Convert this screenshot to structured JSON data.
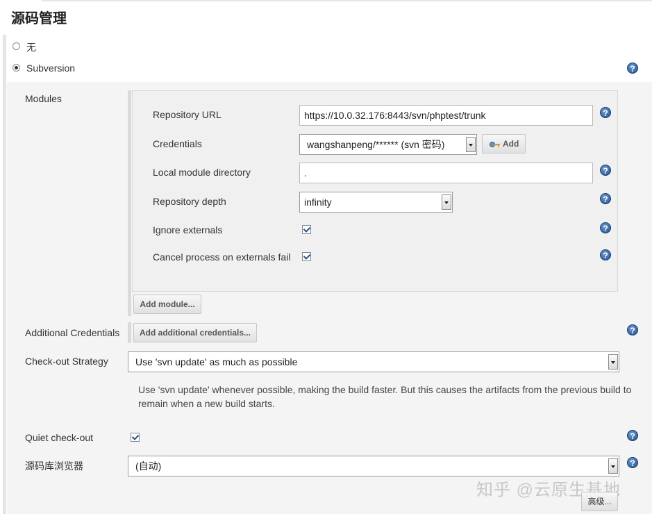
{
  "section": {
    "title": "源码管理"
  },
  "scm_options": [
    {
      "label": "无",
      "selected": false
    },
    {
      "label": "Subversion",
      "selected": true
    }
  ],
  "modules": {
    "label": "Modules",
    "repository_url": {
      "label": "Repository URL",
      "value": "https://10.0.32.176:8443/svn/phptest/trunk"
    },
    "credentials": {
      "label": "Credentials",
      "value": "wangshanpeng/****** (svn 密码)",
      "add_label": "Add"
    },
    "local_module_directory": {
      "label": "Local module directory",
      "value": "."
    },
    "repository_depth": {
      "label": "Repository depth",
      "value": "infinity"
    },
    "ignore_externals": {
      "label": "Ignore externals",
      "checked": true
    },
    "cancel_process": {
      "label": "Cancel process on externals fail",
      "checked": true
    },
    "add_module_label": "Add module..."
  },
  "additional_credentials": {
    "label": "Additional Credentials",
    "button_label": "Add additional credentials..."
  },
  "checkout_strategy": {
    "label": "Check-out Strategy",
    "value": "Use 'svn update' as much as possible",
    "description": "Use 'svn update' whenever possible, making the build faster. But this causes the artifacts from the previous build to remain when a new build starts."
  },
  "quiet_checkout": {
    "label": "Quiet check-out",
    "checked": false
  },
  "repo_browser": {
    "label": "源码库浏览器",
    "value": "(自动)"
  },
  "advanced_label": "高级...",
  "help_glyph": "?",
  "watermark": "知乎 @云原生基地",
  "colors": {
    "help_blue": "#1f4f8f",
    "panel_bg": "#f4f4f4"
  }
}
